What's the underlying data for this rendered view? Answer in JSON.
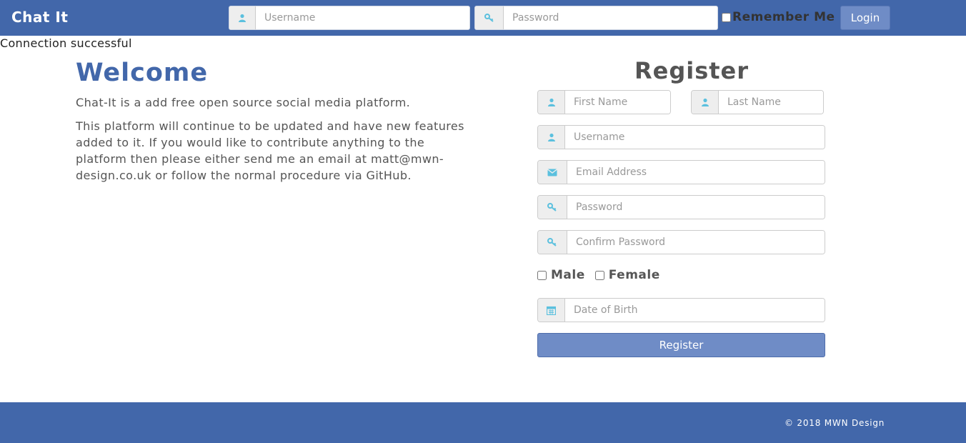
{
  "navbar": {
    "brand": "Chat It",
    "username_placeholder": "Username",
    "password_placeholder": "Password",
    "remember_label": "Remember Me",
    "login_label": "Login"
  },
  "status": {
    "connection_text": "Connection successful"
  },
  "welcome": {
    "title": "Welcome",
    "paragraph1": "Chat-It is a add free open source social media platform.",
    "paragraph2": "This platform will continue to be updated and have new features added to it. If you would like to contribute anything to the platform then please either send me an email at matt@mwn-design.co.uk or follow the normal procedure via GitHub."
  },
  "register": {
    "title": "Register",
    "first_name_placeholder": "First Name",
    "last_name_placeholder": "Last Name",
    "username_placeholder": "Username",
    "email_placeholder": "Email Address",
    "password_placeholder": "Password",
    "confirm_password_placeholder": "Confirm Password",
    "male_label": "Male",
    "female_label": "Female",
    "dob_placeholder": "Date of Birth",
    "submit_label": "Register"
  },
  "footer": {
    "copyright": "© 2018 MWN Design"
  },
  "colors": {
    "brand_blue": "#4267aa",
    "button_blue": "#6f8cc6",
    "icon_blue": "#5bc0de"
  },
  "icons": {
    "user": "user-icon",
    "key": "key-icon",
    "envelope": "envelope-icon",
    "calendar": "calendar-icon"
  }
}
